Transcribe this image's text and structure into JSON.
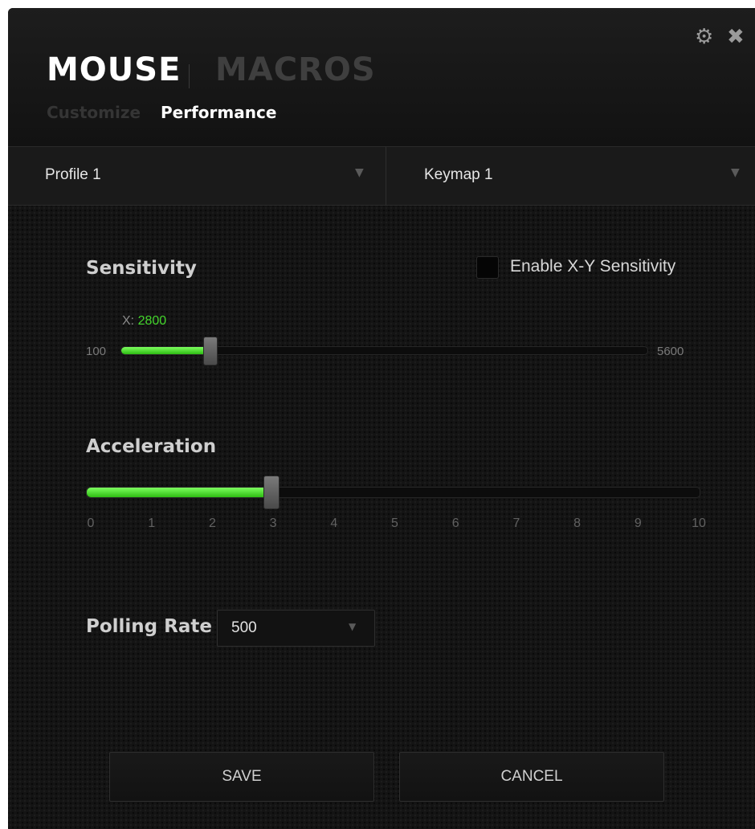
{
  "header": {
    "tabs": [
      "MOUSE",
      "MACROS"
    ],
    "subtabs": [
      "Customize",
      "Performance"
    ],
    "active_tab": "MOUSE",
    "active_subtab": "Performance",
    "icons": [
      "gear-icon",
      "close-icon"
    ]
  },
  "dropdowns": {
    "profile": "Profile 1",
    "keymap": "Keymap 1"
  },
  "sensitivity": {
    "label": "Sensitivity",
    "enable_xy_label": "Enable X-Y Sensitivity",
    "enable_xy_checked": false,
    "x_prefix": "X:",
    "x_value": "2800",
    "min": "100",
    "max": "5600"
  },
  "acceleration": {
    "label": "Acceleration",
    "value": 3,
    "ticks": [
      "0",
      "1",
      "2",
      "3",
      "4",
      "5",
      "6",
      "7",
      "8",
      "9",
      "10"
    ]
  },
  "polling": {
    "label": "Polling Rate",
    "value": "500"
  },
  "buttons": {
    "save": "SAVE",
    "cancel": "CANCEL"
  },
  "colors": {
    "accent": "#44d62c",
    "background": "#141414"
  }
}
